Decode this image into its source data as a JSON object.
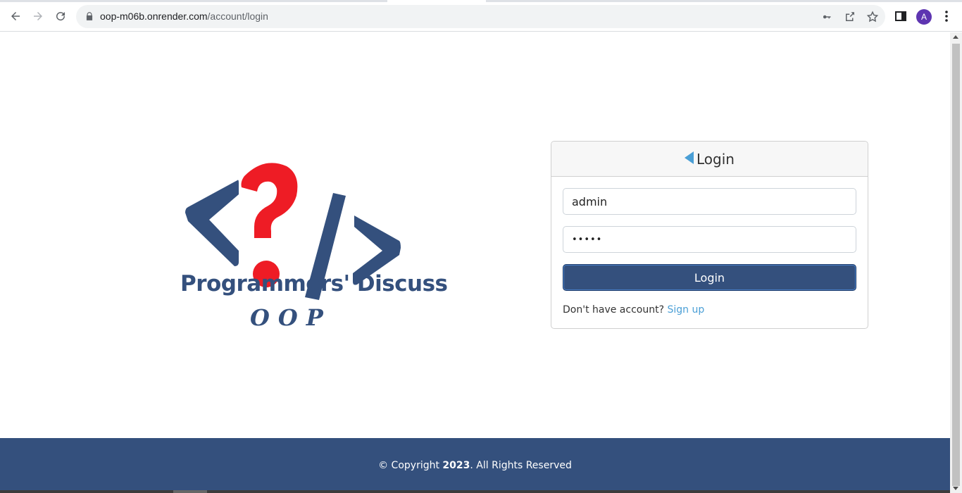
{
  "browser": {
    "url_host": "oop-m06b.onrender.com",
    "url_path": "/account/login",
    "avatar_letter": "A",
    "icons": [
      "back-icon",
      "forward-icon",
      "reload-icon",
      "lock-icon",
      "key-icon",
      "share-icon",
      "star-icon",
      "side-panel-icon",
      "menu-icon"
    ]
  },
  "logo": {
    "title": "Programmers' Discuss",
    "subtitle": "OOP",
    "colors": {
      "brackets": "#34507d",
      "question": "#ee1c25"
    }
  },
  "login_card": {
    "header": "Login",
    "username_value": "admin",
    "password_mask": "•••••",
    "button_label": "Login",
    "signup_prompt": "Don't have account?",
    "signup_link": "Sign up"
  },
  "footer": {
    "prefix": "© Copyright ",
    "year": "2023",
    "suffix": ". All Rights Reserved"
  },
  "colors": {
    "primary": "#34507d",
    "link": "#4a9fd6",
    "accent_red": "#ee1c25"
  }
}
